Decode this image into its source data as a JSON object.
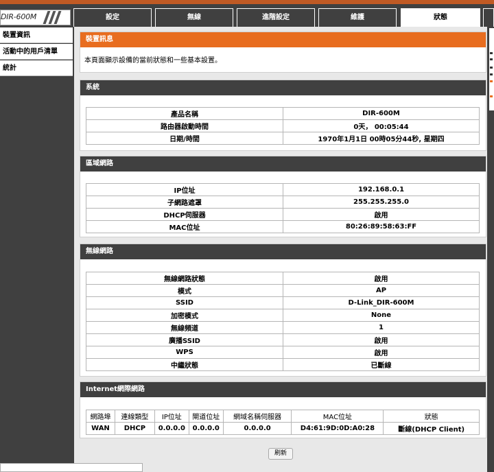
{
  "header": {
    "model": "DIR-600M",
    "tabs": [
      {
        "label": "設定"
      },
      {
        "label": "無線"
      },
      {
        "label": "進階設定"
      },
      {
        "label": "維護"
      },
      {
        "label": "狀態",
        "active": true
      }
    ]
  },
  "sidebar": {
    "items": [
      {
        "label": "裝置資訊"
      },
      {
        "label": "活動中的用戶清單"
      },
      {
        "label": "統計"
      }
    ]
  },
  "intro": {
    "title": "裝置訊息",
    "text": "本頁面顯示設備的當前狀態和一些基本設置。"
  },
  "system": {
    "title": "系統",
    "rows": [
      {
        "label": "產品名稱",
        "value": "DIR-600M"
      },
      {
        "label": "路由器啟動時間",
        "value": "0天， 00:05:44"
      },
      {
        "label": "日期/時間",
        "value": "1970年1月1日 00時05分44秒, 星期四"
      }
    ]
  },
  "lan": {
    "title": "區域網路",
    "rows": [
      {
        "label": "IP位址",
        "value": "192.168.0.1"
      },
      {
        "label": "子網路遮罩",
        "value": "255.255.255.0"
      },
      {
        "label": "DHCP伺服器",
        "value": "啟用"
      },
      {
        "label": "MAC位址",
        "value": "80:26:89:58:63:FF"
      }
    ]
  },
  "wireless": {
    "title": "無線網路",
    "rows": [
      {
        "label": "無線網路狀態",
        "value": "啟用"
      },
      {
        "label": "模式",
        "value": "AP"
      },
      {
        "label": "SSID",
        "value": "D-Link_DIR-600M"
      },
      {
        "label": "加密模式",
        "value": "None"
      },
      {
        "label": "無線頻道",
        "value": "1"
      },
      {
        "label": "廣播SSID",
        "value": "啟用"
      },
      {
        "label": "WPS",
        "value": "啟用"
      },
      {
        "label": "中繼狀態",
        "value": "已斷線"
      }
    ]
  },
  "internet": {
    "title": "Internet網際網路",
    "columns": [
      "網路埠",
      "連線類型",
      "IP位址",
      "閘道位址",
      "網域名稱伺服器",
      "MAC位址",
      "狀態"
    ],
    "row": [
      "WAN",
      "DHCP",
      "0.0.0.0",
      "0.0.0.0",
      "0.0.0.0",
      "D4:61:9D:0D:A0:28",
      "斷線(DHCP Client)"
    ]
  },
  "actions": {
    "refresh_label": "刷新"
  }
}
